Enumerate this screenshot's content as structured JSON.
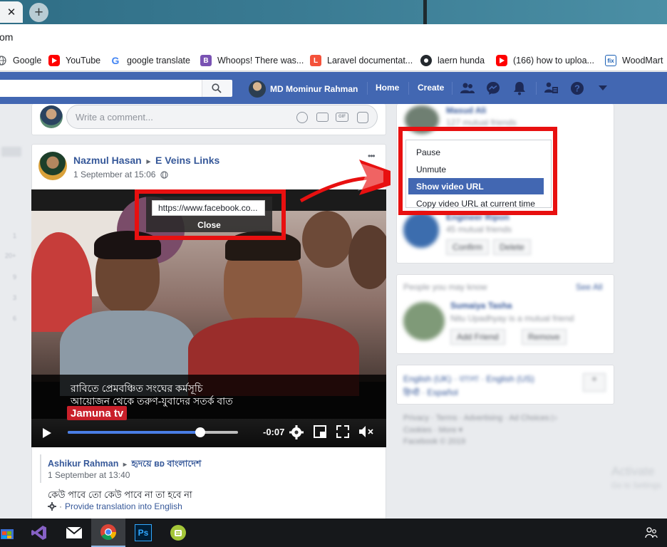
{
  "browser": {
    "tab_close_glyph": "✕",
    "new_tab_glyph": "+",
    "address_fragment": "om",
    "bookmarks": [
      {
        "label": "Google",
        "icon": "globe-icon"
      },
      {
        "label": "YouTube",
        "icon": "youtube-icon"
      },
      {
        "label": "google translate",
        "icon": "google-icon"
      },
      {
        "label": "Whoops! There was...",
        "icon": "bootstrap-icon"
      },
      {
        "label": "Laravel documentat...",
        "icon": "laravel-icon"
      },
      {
        "label": "laern hunda",
        "icon": "github-icon"
      },
      {
        "label": "(166) how to uploa...",
        "icon": "youtube-icon"
      },
      {
        "label": "WoodMart",
        "icon": "woodmart-icon"
      }
    ]
  },
  "fb_header": {
    "user_name": "MD Mominur Rahman",
    "home_label": "Home",
    "create_label": "Create",
    "brand_color": "#4267b2"
  },
  "composer": {
    "placeholder": "Write a comment..."
  },
  "post": {
    "author": "Nazmul Hasan",
    "target": "E Veins Links",
    "separator": "▸",
    "date": "1 September at 15:06",
    "more_glyph": "•••",
    "video": {
      "caption_line1": "রাবিতে প্রেমবঞ্চিত সংঘের কর্মসূচি",
      "caption_line2": "আয়োজন থেকে তরুণ-যুবাদের সতর্ক বাত",
      "channel_logo": "Jamuna tv",
      "time_remaining": "-0:07",
      "progress": 0.78
    },
    "url_popup": {
      "url": "https://www.facebook.co...",
      "close_label": "Close"
    }
  },
  "context_menu": {
    "items": [
      {
        "label": "Pause",
        "active": false
      },
      {
        "label": "Unmute",
        "active": false
      },
      {
        "label": "Show video URL",
        "active": true
      },
      {
        "label": "Copy video URL at current time",
        "active": false
      }
    ]
  },
  "shared_post": {
    "author": "Ashikur Rahman",
    "separator": "▸",
    "target": "হৃদয়ে ʙᴅ বাংলাদেশ",
    "date": "1 September at 13:40",
    "text": "কেউ পাবে তো কেউ পাবে না তা হবে না",
    "translate_link": "Provide translation into English",
    "translate_prefix": "·"
  },
  "right_column_blurred": {
    "friend1_name": "Masud Ali",
    "friend1_mutual": "127 mutual friends",
    "friend2_name": "Engineer Ripon",
    "friend2_mutual": "45 mutual friends",
    "confirm_label": "Confirm",
    "delete_label": "Delete",
    "pymk_title": "People you may know",
    "see_all": "See All",
    "pymk_name": "Sumaiya Tasha",
    "pymk_sub": "Nitu Upadhyay is a mutual friend",
    "add_friend": "Add Friend",
    "remove": "Remove",
    "lang_line1": "English (UK) · বাংলা · English (US)",
    "lang_line2": "हिन्दी · Español",
    "footer1": "Privacy · Terms · Advertising · Ad Choices ▷",
    "footer2": "Cookies · More ▾",
    "footer3": "Facebook © 2019",
    "activate1": "Activate",
    "activate2": "Go to Settings"
  },
  "taskbar": {
    "apps": [
      "windows-store-icon",
      "visual-studio-icon",
      "mail-icon",
      "chrome-icon",
      "photoshop-icon",
      "android-icon"
    ],
    "ps_label": "Ps"
  }
}
